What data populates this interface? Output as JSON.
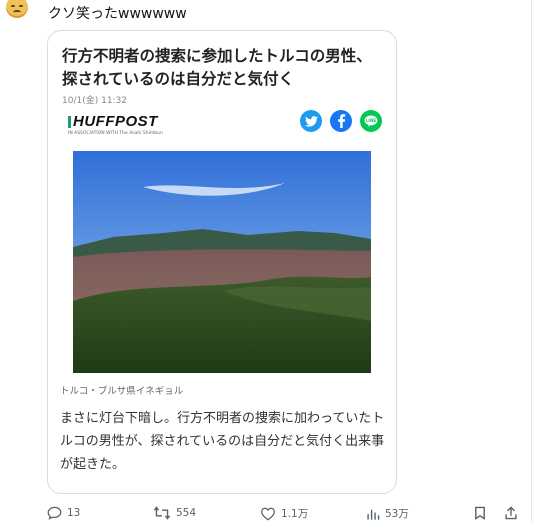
{
  "post": {
    "text": "クソ笑ったwwwwww"
  },
  "card": {
    "headline": "行方不明者の捜索に参加したトルコの男性、探されているのは自分だと気付く",
    "date": "10/1(金) 11:32",
    "logo": {
      "name": "HUFFPOST",
      "sub": "IN ASSOCIATION WITH The Asahi Shimbun"
    },
    "share_icons": [
      "twitter-icon",
      "facebook-icon",
      "line-icon"
    ],
    "caption": "トルコ・ブルサ県イネギョル",
    "body": "まさに灯台下暗し。行方不明者の捜索に加わっていたトルコの男性が、探されているのは自分だと気付く出来事が起きた。"
  },
  "actions": {
    "replies": "13",
    "reposts": "554",
    "likes": "1.1万",
    "views": "53万"
  },
  "colors": {
    "twitter": "#1d9bf0",
    "facebook": "#1877f2",
    "line": "#06c755"
  }
}
